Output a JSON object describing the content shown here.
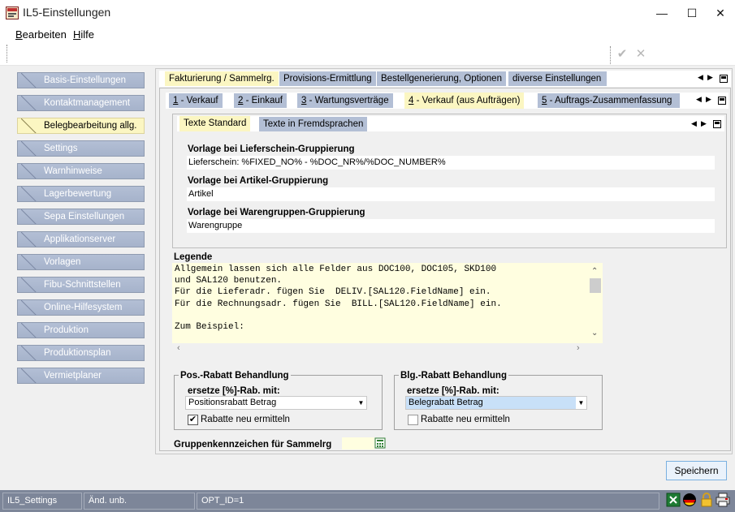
{
  "window": {
    "title": "IL5-Einstellungen",
    "minimize": "—",
    "maximize": "☐",
    "close": "✕"
  },
  "menu": {
    "items": [
      {
        "accel": "B",
        "rest": "earbeiten"
      },
      {
        "accel": "H",
        "rest": "ilfe"
      }
    ]
  },
  "sidebar": {
    "items": [
      {
        "label": "Basis-Einstellungen"
      },
      {
        "label": "Kontaktmanagement"
      },
      {
        "label": "Belegbearbeitung allg."
      },
      {
        "label": "Settings"
      },
      {
        "label": "Warnhinweise"
      },
      {
        "label": "Lagerbewertung"
      },
      {
        "label": "Sepa Einstellungen"
      },
      {
        "label": "Applikationserver"
      },
      {
        "label": "Vorlagen"
      },
      {
        "label": "Fibu-Schnittstellen"
      },
      {
        "label": "Online-Hilfesystem"
      },
      {
        "label": "Produktion"
      },
      {
        "label": "Produktionsplan"
      },
      {
        "label": "Vermietplaner"
      }
    ],
    "active_index": 2
  },
  "tabs_level1": [
    "Fakturierung / Sammelrg.",
    "Provisions-Ermittlung",
    "Bestellgenerierung, Optionen",
    "diverse Einstellungen"
  ],
  "tabs_level2": [
    {
      "num": "1",
      "label": " - Verkauf"
    },
    {
      "num": "2",
      "label": " - Einkauf"
    },
    {
      "num": "3",
      "label": " - Wartungsverträge"
    },
    {
      "num": "4",
      "label": " - Verkauf (aus Aufträgen)"
    },
    {
      "num": "5",
      "label": " - Auftrags-Zusammenfassung"
    }
  ],
  "tabs_level3": [
    "Texte Standard",
    "Texte in Fremdsprachen"
  ],
  "templates": [
    {
      "label": "Vorlage bei Lieferschein-Gruppierung",
      "value": "Lieferschein: %FIXED_NO% - %DOC_NR%/%DOC_NUMBER%"
    },
    {
      "label": "Vorlage bei Artikel-Gruppierung",
      "value": "Artikel"
    },
    {
      "label": "Vorlage bei Warengruppen-Gruppierung",
      "value": "Warengruppe"
    }
  ],
  "legend": {
    "title": "Legende",
    "text": "Allgemein lassen sich alle Felder aus DOC100, DOC105, SKD100\nund SAL120 benutzen.\nFür die Lieferadr. fügen Sie  DELIV.[SAL120.FieldName] ein.\nFür die Rechnungsadr. fügen Sie  BILL.[SAL120.FieldName] ein.\n\nZum Beispiel:"
  },
  "pos_rabatt": {
    "title": "Pos.-Rabatt Behandlung",
    "label": "ersetze [%]-Rab. mit:",
    "selected": "Positionsrabatt Betrag",
    "checkbox_label": "Rabatte neu ermitteln",
    "checked": true
  },
  "blg_rabatt": {
    "title": "Blg.-Rabatt Behandlung",
    "label": "ersetze [%]-Rab.  mit:",
    "selected": "Belegrabatt Betrag",
    "checkbox_label": "Rabatte neu ermitteln",
    "checked": false
  },
  "gruppen": {
    "label": "Gruppenkennzeichen für Sammelrg",
    "value": ""
  },
  "buttons": {
    "save": "Speichern"
  },
  "statusbar": {
    "cells": [
      "IL5_Settings",
      "Änd. unb.",
      "OPT_ID=1"
    ]
  },
  "colors": {
    "nav_blue": "#a9b6ce",
    "active_yellow": "#fbf6c2",
    "status_bar": "#7d8699",
    "legend_bg": "#fffee0"
  }
}
